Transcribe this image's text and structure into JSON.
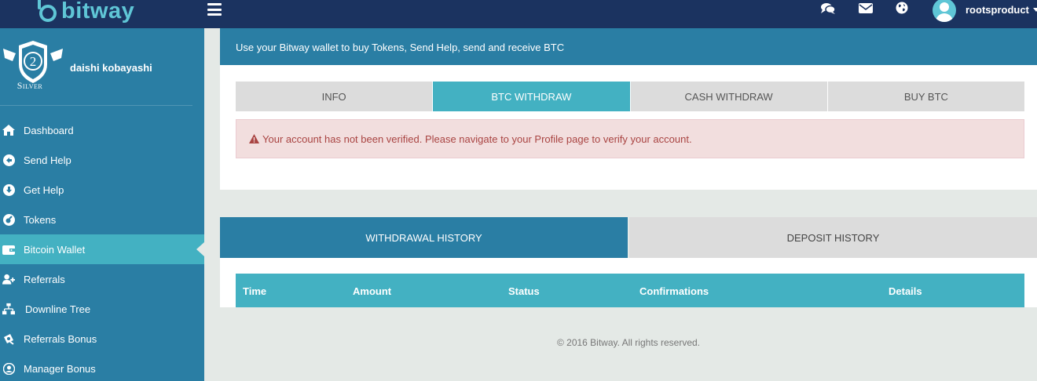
{
  "brand": {
    "name": "bitway",
    "color": "#5fc6d6"
  },
  "header": {
    "menu_icon": "hamburger-icon",
    "icons": [
      "comments-icon",
      "envelope-icon",
      "globe-icon"
    ],
    "username": "rootsproduct"
  },
  "profile": {
    "badge_number": "2",
    "badge_label": "Silver",
    "name": "daishi kobayashi"
  },
  "sidebar": {
    "items": [
      {
        "label": "Dashboard",
        "icon": "home-icon"
      },
      {
        "label": "Send Help",
        "icon": "send-circle-icon"
      },
      {
        "label": "Get Help",
        "icon": "download-circle-icon"
      },
      {
        "label": "Tokens",
        "icon": "token-icon"
      },
      {
        "label": "Bitcoin Wallet",
        "icon": "wallet-icon",
        "active": true
      },
      {
        "label": "Referrals",
        "icon": "users-icon"
      },
      {
        "label": "Downline Tree",
        "icon": "sitemap-icon"
      },
      {
        "label": "Referrals Bonus",
        "icon": "gift-icon"
      },
      {
        "label": "Manager Bonus",
        "icon": "user-circle-icon"
      }
    ]
  },
  "hero": {
    "subtitle": "Use your Bitway wallet to buy Tokens, Send Help, send and receive BTC"
  },
  "wallet_tabs": [
    {
      "label": "INFO",
      "active": false
    },
    {
      "label": "BTC WITHDRAW",
      "active": true
    },
    {
      "label": "CASH WITHDRAW",
      "active": false
    },
    {
      "label": "BUY BTC",
      "active": false
    }
  ],
  "alert": {
    "message": "Your account has not been verified. Please navigate to your Profile page to verify your account.",
    "icon": "warning-icon"
  },
  "history_tabs": [
    {
      "label": "WITHDRAWAL HISTORY",
      "active": true
    },
    {
      "label": "DEPOSIT HISTORY",
      "active": false
    }
  ],
  "table": {
    "columns": [
      "Time",
      "Amount",
      "Status",
      "Confirmations",
      "Details"
    ]
  },
  "footer": {
    "text": "© 2016 Bitway. All rights reserved."
  },
  "colors": {
    "navy": "#1b3360",
    "primary": "#2a7ea4",
    "teal": "#43b1c2",
    "alert_bg": "#f2dede",
    "alert_text": "#a94442"
  }
}
